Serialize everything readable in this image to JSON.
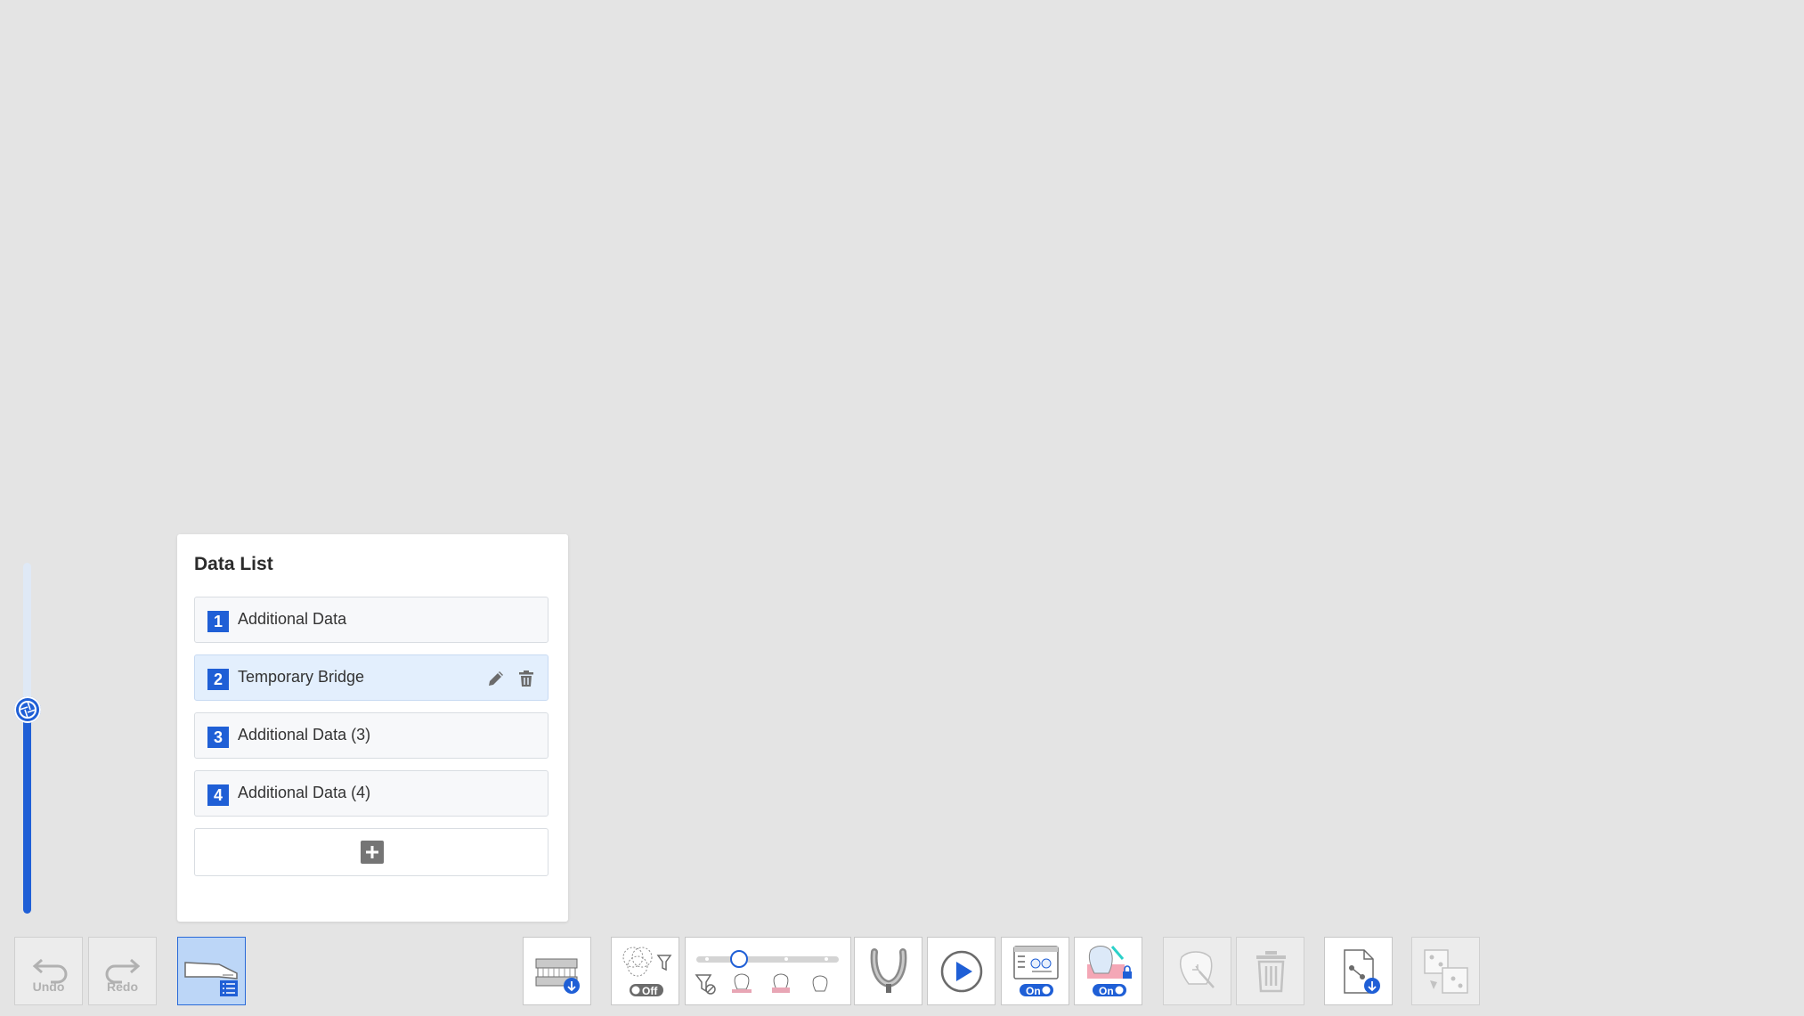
{
  "data_list": {
    "title": "Data List",
    "items": [
      {
        "number": "1",
        "label": "Additional Data",
        "selected": false
      },
      {
        "number": "2",
        "label": "Temporary Bridge",
        "selected": true
      },
      {
        "number": "3",
        "label": "Additional Data (3)",
        "selected": false
      },
      {
        "number": "4",
        "label": "Additional Data (4)",
        "selected": false
      }
    ]
  },
  "toolbar": {
    "undo_label": "Undo",
    "redo_label": "Redo",
    "filter_toggle": "Off",
    "display_toggle": "On",
    "lock_toggle": "On",
    "filter_slider_level": 0.3
  },
  "brightness_level": 0.58,
  "colors": {
    "accent": "#1f5fd6",
    "background": "#e4e4e4",
    "selected_row": "#e3effd",
    "active_button": "#bcd6f7"
  }
}
